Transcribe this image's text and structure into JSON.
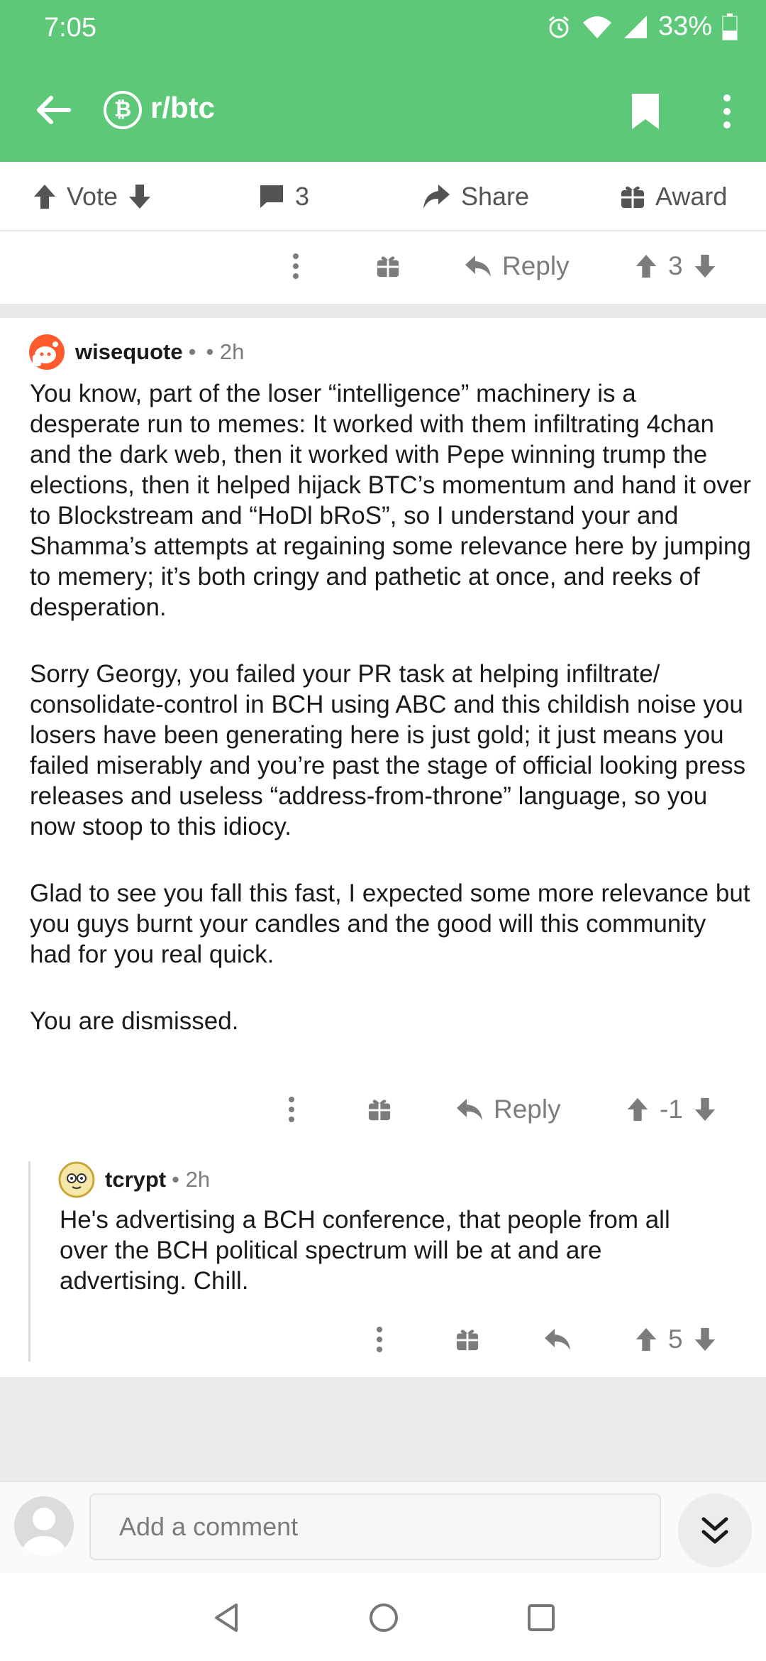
{
  "status": {
    "time": "7:05",
    "battery": "33%"
  },
  "header": {
    "subreddit": "r/btc",
    "sub_icon_glyph": "₿",
    "accent": "#5ec879"
  },
  "post_actions": {
    "vote_label": "Vote",
    "comment_count": "3",
    "share_label": "Share",
    "award_label": "Award"
  },
  "parent_actions": {
    "reply_label": "Reply",
    "score": "3"
  },
  "comments": [
    {
      "author": "wisequote",
      "separator": "•",
      "age": "• 2h",
      "paragraphs": [
        "You know, part of the loser “intelligence” machinery is a desperate run to memes: It worked with them infiltrating 4chan and the dark web, then it worked with Pepe winning trump the elections, then it helped hijack BTC’s momentum and hand it over to Blockstream and “HoDl bRoS”, so I understand your and Shamma’s attempts at regaining some relevance here by jumping to memery; it’s both cringy and pathetic at once, and reeks of desperation.",
        "Sorry Georgy, you failed your PR task at helping infiltrate/ consolidate-control in BCH using ABC and this childish noise you losers have been generating here is just gold; it just means you failed miserably and you’re past the stage of official looking press releases and useless “address-from-throne” language, so you now stoop to this idiocy.",
        "Glad to see you fall this fast, I expected some more relevance but you guys burnt your candles and the good will this community had for you real quick.",
        "You are dismissed."
      ],
      "reply_label": "Reply",
      "score": "-1"
    },
    {
      "author": "tcrypt",
      "age": "• 2h",
      "paragraphs": [
        "He's advertising a BCH conference, that people from all over the BCH political spectrum will be at and are advertising. Chill."
      ],
      "score": "5"
    }
  ],
  "compose": {
    "placeholder": "Add a comment"
  },
  "icons": [
    "back-arrow-icon",
    "bitcoin-icon",
    "bookmark-icon",
    "more-vertical-icon",
    "upvote-icon",
    "downvote-icon",
    "comment-icon",
    "share-icon",
    "award-icon",
    "reply-icon",
    "collapse-icon",
    "nav-back-icon",
    "nav-home-icon",
    "nav-recents-icon"
  ]
}
